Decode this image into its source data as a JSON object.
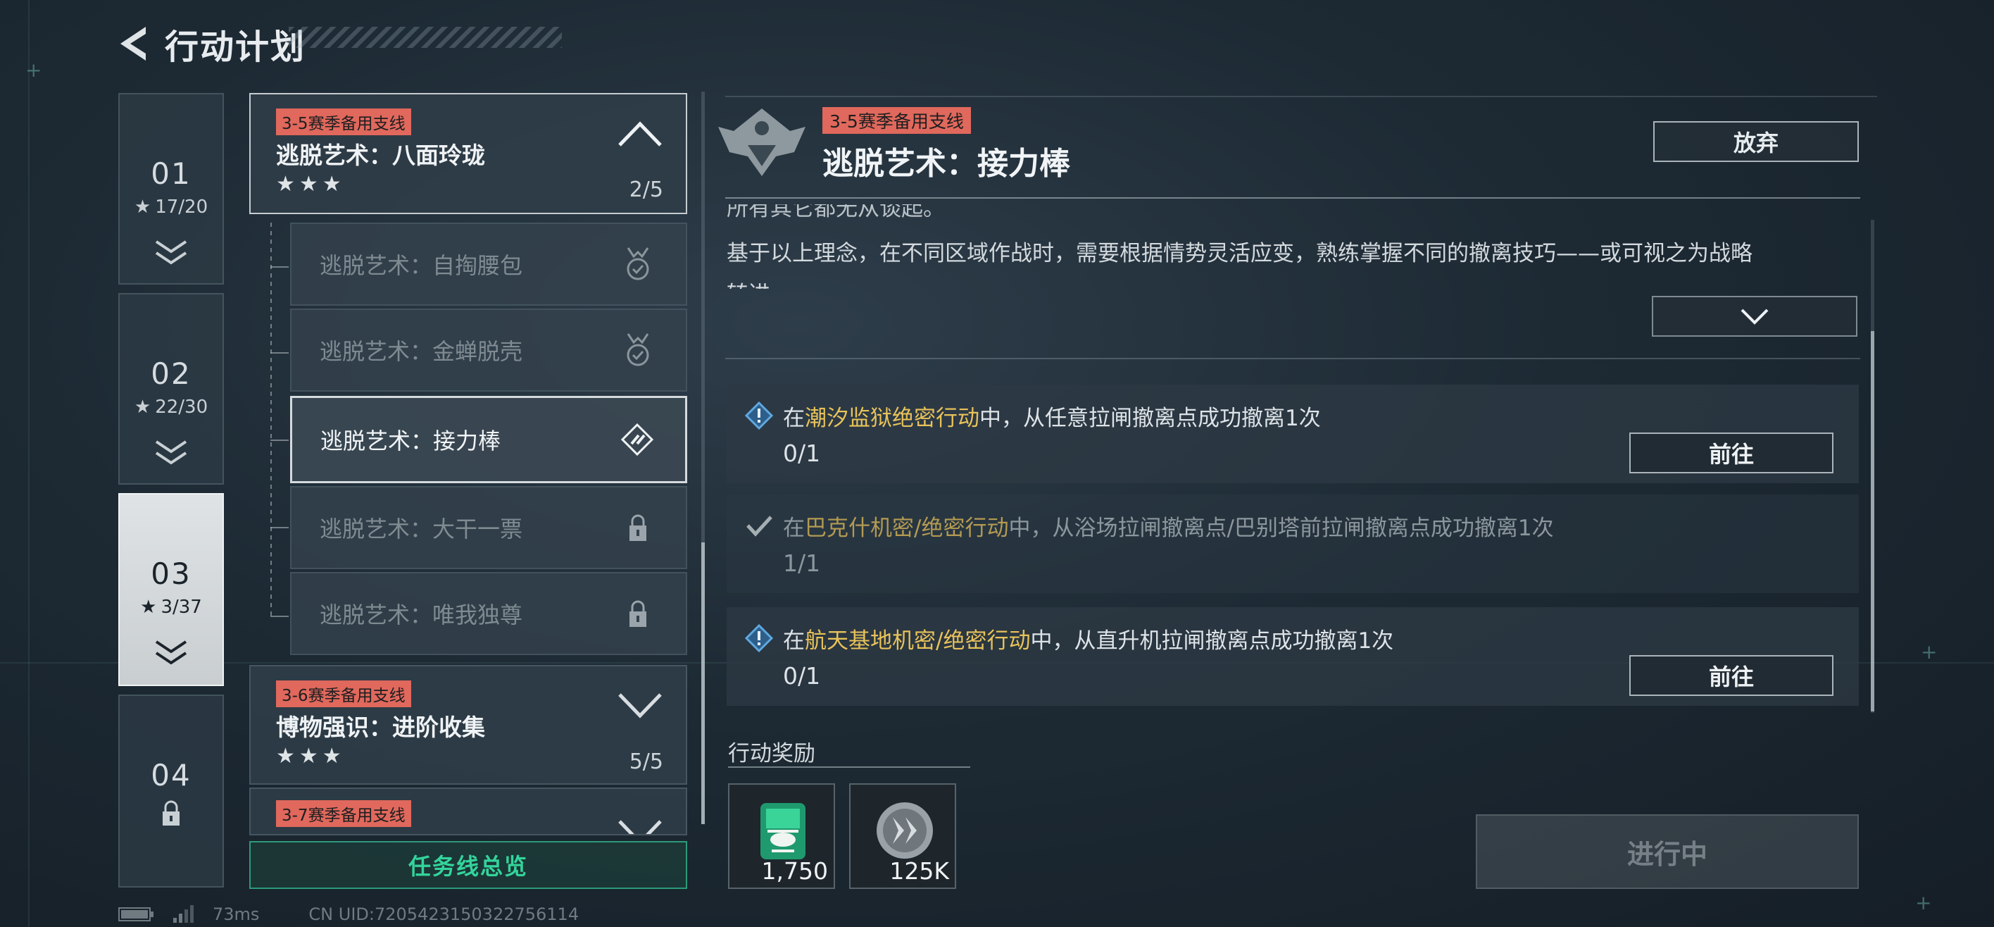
{
  "header": {
    "title": "行动计划"
  },
  "seasons": [
    {
      "num": "01",
      "stars": "17/20"
    },
    {
      "num": "02",
      "stars": "22/30"
    },
    {
      "num": "03",
      "stars": "3/37"
    },
    {
      "num": "04",
      "stars": ""
    }
  ],
  "chapters": [
    {
      "tag": "3-5赛季备用支线",
      "title": "逃脱艺术：八面玲珑",
      "stars": "★★★",
      "progress": "2/5"
    },
    {
      "tag": "3-6赛季备用支线",
      "title": "博物强识：进阶收集",
      "stars": "★★★",
      "progress": "5/5"
    },
    {
      "tag": "3-7赛季备用支线",
      "title": "",
      "stars": "",
      "progress": ""
    }
  ],
  "missions": [
    {
      "label": "逃脱艺术：自掏腰包",
      "state": "completed"
    },
    {
      "label": "逃脱艺术：金蝉脱壳",
      "state": "completed"
    },
    {
      "label": "逃脱艺术：接力棒",
      "state": "active"
    },
    {
      "label": "逃脱艺术：大干一票",
      "state": "locked"
    },
    {
      "label": "逃脱艺术：唯我独尊",
      "state": "locked"
    }
  ],
  "overview_button": "任务线总览",
  "status_bar": {
    "ping": "73ms",
    "uid": "CN UID:7205423150322756114"
  },
  "detail": {
    "tag": "3-5赛季备用支线",
    "title": "逃脱艺术：接力棒",
    "abandon": "放弃",
    "desc_line0": "所有其它都无从谈起。",
    "desc_line1": "基于以上理念，在不同区域作战时，需要根据情势灵活应变，熟练掌握不同的撤离技巧——或可视之为战略",
    "desc_line2": "转进"
  },
  "tasks": [
    {
      "pre": "在",
      "highlight": "潮汐监狱绝密行动",
      "post": "中，从任意拉闸撤离点成功撤离1次",
      "count": "0/1",
      "go": "前往",
      "done": false
    },
    {
      "pre": "在",
      "highlight": "巴克什机密/绝密行动",
      "post": "中，从浴场拉闸撤离点/巴别塔前拉闸撤离点成功撤离1次",
      "count": "1/1",
      "go": "",
      "done": true
    },
    {
      "pre": "在",
      "highlight": "航天基地机密/绝密行动",
      "post": "中，从直升机拉闸撤离点成功撤离1次",
      "count": "0/1",
      "go": "前往",
      "done": false
    }
  ],
  "rewards": {
    "label": "行动奖励",
    "items": [
      {
        "icon": "helicopter-ticket-icon",
        "count": "1,750"
      },
      {
        "icon": "silver-coin-icon",
        "count": "125K"
      }
    ]
  },
  "progress_button": "进行中",
  "colors": {
    "tag": "#e0685c",
    "highlight": "#e8c25a",
    "overview": "#33d49b"
  }
}
